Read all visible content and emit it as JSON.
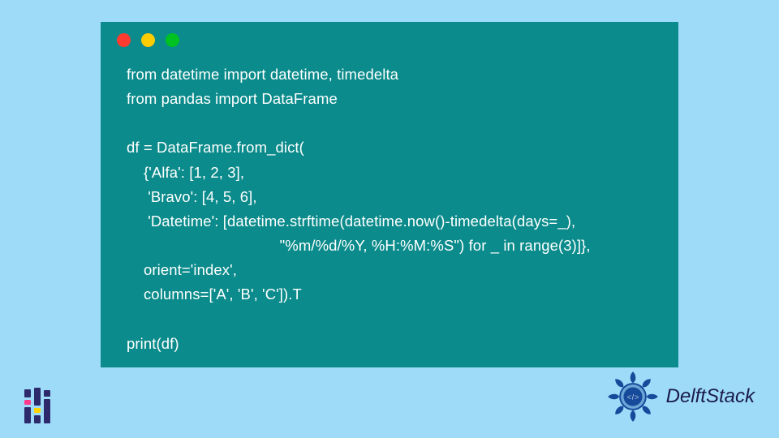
{
  "code": {
    "lines": [
      "from datetime import datetime, timedelta",
      "from pandas import DataFrame",
      "",
      "df = DataFrame.from_dict(",
      "    {'Alfa': [1, 2, 3],",
      "     'Bravo': [4, 5, 6],",
      "     'Datetime': [datetime.strftime(datetime.now()-timedelta(days=_),",
      "                                    \"%m/%d/%Y, %H:%M:%S\") for _ in range(3)]},",
      "    orient='index',",
      "    columns=['A', 'B', 'C']).T",
      "",
      "print(df)"
    ]
  },
  "window": {
    "dot_red": "red",
    "dot_yellow": "yellow",
    "dot_green": "green"
  },
  "brand": {
    "name": "DelftStack"
  },
  "colors": {
    "page_bg": "#9edbf9",
    "code_bg": "#0b8b8b",
    "code_fg": "#ffffff",
    "brand_fg": "#1a1a4d"
  }
}
